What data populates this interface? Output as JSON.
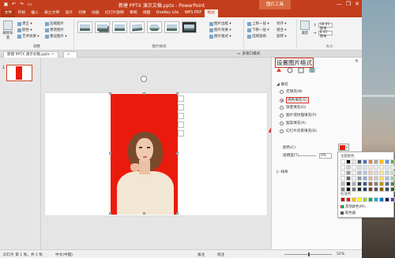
{
  "window": {
    "title": "新建 PPTX 演示文稿.pptx - PowerPoint",
    "context_tab_label": "图片工具",
    "minimize": "—",
    "restore": "❐",
    "close": "✕"
  },
  "ribbon_tabs": [
    "文件",
    "开始",
    "插入",
    "表之大师",
    "设计",
    "切换",
    "动画",
    "幻灯片放映",
    "审阅",
    "视图",
    "OneKey Lite",
    "WPS PDF",
    "格式"
  ],
  "ribbon": {
    "remove_bg": "删除背景",
    "adjust": [
      "更正 ▾",
      "颜色 ▾",
      "艺术效果 ▾"
    ],
    "adjust2": [
      "压缩图片",
      "更改图片",
      "重设图片 ▾"
    ],
    "group_adjust": "调整",
    "group_styles": "图片样式",
    "styles_right": [
      "图片边框 ▾",
      "图片效果 ▾",
      "图片版式 ▾"
    ],
    "arrange": [
      "上移一层 ▾",
      "下移一层 ▾",
      "选择窗格"
    ],
    "arrange2": [
      "对齐 ▾",
      "组合 ▾",
      "旋转 ▾"
    ],
    "crop": "裁剪",
    "height": "18.05 厘米",
    "width": "8.45 厘米",
    "group_size": "大小"
  },
  "doc_tabs": {
    "active": "新建 PPTX 演示文稿.pptx",
    "close": "✕",
    "second": "多窗口模式"
  },
  "thumbnails": {
    "slide_number": "1"
  },
  "pane": {
    "title": "设置图片格式",
    "close": "✕",
    "fill_section": "◢ 填充",
    "fill_options": [
      "无填充(N)",
      "纯色填充(S)",
      "渐变填充(G)",
      "图片或纹理填充(P)",
      "图案填充(A)",
      "幻灯片背景填充(B)"
    ],
    "color_label": "颜色(C)",
    "transparency_label": "透明度(T)",
    "transparency_value": "0%",
    "line_section": "▷ 线条"
  },
  "color_dropdown": {
    "theme_label": "主题颜色",
    "standard_label": "标准色",
    "more_colors": "其他颜色(M)...",
    "eyedropper": "取色器",
    "theme_colors": [
      "#ffffff",
      "#000000",
      "#e7e6e6",
      "#44546a",
      "#4472c4",
      "#ed7d31",
      "#a5a5a5",
      "#ffc000",
      "#5b9bd5",
      "#70ad47"
    ],
    "standard_colors": [
      "#c00000",
      "#ff0000",
      "#ffc000",
      "#ffff00",
      "#92d050",
      "#00b050",
      "#00b0f0",
      "#0070c0",
      "#002060",
      "#7030a0"
    ]
  },
  "status": {
    "slide": "幻灯片 第 1 张，共 1 张",
    "lang": "中文(中国)",
    "notes": "备注",
    "comments": "批注",
    "zoom": "52%"
  },
  "colors": {
    "accent": "#c43e1c",
    "highlight": "#d02c23",
    "photo_bg": "#ea1b0c"
  }
}
